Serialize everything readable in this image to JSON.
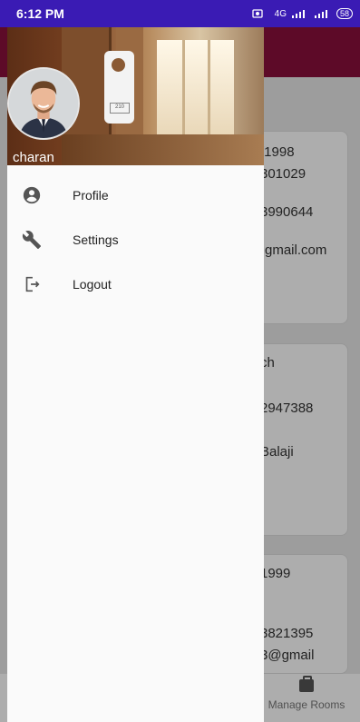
{
  "status_bar": {
    "time": "6:12 PM",
    "network_label": "4G",
    "battery": "58"
  },
  "drawer": {
    "user_name": "charan",
    "menu": [
      {
        "label": "Profile",
        "icon": "account-circle-icon"
      },
      {
        "label": "Settings",
        "icon": "wrench-icon"
      },
      {
        "label": "Logout",
        "icon": "logout-icon"
      }
    ]
  },
  "background": {
    "cards": [
      {
        "lines": [
          "/1998",
          "301029",
          "3990644",
          ")gmail.com"
        ]
      },
      {
        "lines": [
          "ch",
          "2947388",
          "Balaji"
        ]
      },
      {
        "lines": [
          "1999",
          "3821395",
          "3@gmail"
        ]
      }
    ],
    "bottom_nav": {
      "manage_rooms_label": "Manage Rooms"
    }
  },
  "colors": {
    "status_bar": "#3a1bb4",
    "app_bar": "#8a0f3c",
    "drawer_bg": "#fafafa",
    "scrim": "rgba(0,0,0,0.32)"
  }
}
